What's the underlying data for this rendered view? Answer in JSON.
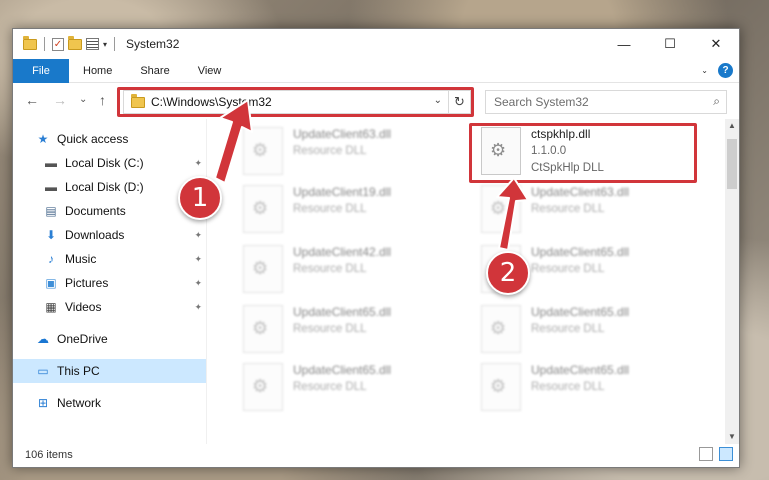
{
  "window": {
    "title": "System32",
    "controls": {
      "minimize": "—",
      "maximize": "☐",
      "close": "✕"
    }
  },
  "ribbon": {
    "tabs": [
      "File",
      "Home",
      "Share",
      "View"
    ],
    "expand": "⌄",
    "help": "?"
  },
  "nav": {
    "back": "←",
    "forward": "→",
    "recent": "⌄",
    "up": "↑",
    "address": "C:\\Windows\\System32",
    "address_dropdown": "⌄",
    "refresh": "↻",
    "search_placeholder": "Search System32",
    "search_icon": "⌕"
  },
  "sidebar": {
    "items": [
      {
        "label": "Quick access",
        "icon": "star-icon",
        "glyph": "★",
        "color": "#2b7fd4",
        "pinned": false
      },
      {
        "label": "Local Disk (C:)",
        "icon": "drive-icon",
        "glyph": "▬",
        "color": "#555555",
        "pinned": true
      },
      {
        "label": "Local Disk (D:)",
        "icon": "drive-icon",
        "glyph": "▬",
        "color": "#555555",
        "pinned": false
      },
      {
        "label": "Documents",
        "icon": "documents-icon",
        "glyph": "▤",
        "color": "#4b6b8e",
        "pinned": true
      },
      {
        "label": "Downloads",
        "icon": "download-icon",
        "glyph": "⬇",
        "color": "#2b7fd4",
        "pinned": true
      },
      {
        "label": "Music",
        "icon": "music-icon",
        "glyph": "♪",
        "color": "#2b7fd4",
        "pinned": true
      },
      {
        "label": "Pictures",
        "icon": "pictures-icon",
        "glyph": "▣",
        "color": "#3f8fd8",
        "pinned": true
      },
      {
        "label": "Videos",
        "icon": "videos-icon",
        "glyph": "▦",
        "color": "#444444",
        "pinned": true
      },
      {
        "label": "OneDrive",
        "icon": "cloud-icon",
        "glyph": "☁",
        "color": "#1976d2",
        "pinned": false
      },
      {
        "label": "This PC",
        "icon": "computer-icon",
        "glyph": "▭",
        "color": "#2b7fd4",
        "pinned": false,
        "selected": true
      },
      {
        "label": "Network",
        "icon": "network-icon",
        "glyph": "⊞",
        "color": "#2b7fd4",
        "pinned": false
      }
    ],
    "pin_glyph": "📌"
  },
  "files": {
    "left_column": [
      {
        "name": "UpdateClient63.dll",
        "type": "Resource DLL"
      },
      {
        "name": "UpdateClient19.dll",
        "type": "Resource DLL"
      },
      {
        "name": "UpdateClient42.dll",
        "type": "Resource DLL"
      },
      {
        "name": "UpdateClient65.dll",
        "type": "Resource DLL"
      },
      {
        "name": "UpdateClient65.dll",
        "type": "Resource DLL"
      }
    ],
    "right_column": [
      {
        "name": "ctspkhlp.dll",
        "version": "1.1.0.0",
        "type": "CtSpkHlp DLL",
        "highlighted": true
      },
      {
        "name": "UpdateClient63.dll",
        "type": "Resource DLL"
      },
      {
        "name": "UpdateClient65.dll",
        "type": "Resource DLL"
      },
      {
        "name": "UpdateClient65.dll",
        "type": "Resource DLL"
      },
      {
        "name": "UpdateClient65.dll",
        "type": "Resource DLL"
      }
    ]
  },
  "status": {
    "item_count": "106 items"
  },
  "callouts": {
    "first": "1",
    "second": "2"
  },
  "colors": {
    "accent": "#1979ca",
    "highlight_red": "#d1353a",
    "selected": "#cce8ff"
  }
}
